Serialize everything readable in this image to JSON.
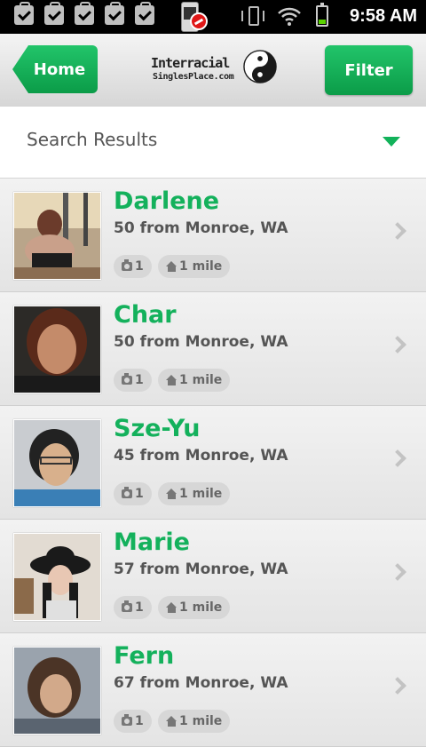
{
  "status_bar": {
    "time": "9:58 AM"
  },
  "header": {
    "home_label": "Home",
    "filter_label": "Filter",
    "logo_line1": "Interracial",
    "logo_line2": "SinglesPlace.com"
  },
  "results": {
    "label": "Search Results"
  },
  "profiles": [
    {
      "name": "Darlene",
      "location": "50 from Monroe, WA",
      "photos": "1",
      "distance": "1 mile"
    },
    {
      "name": "Char",
      "location": "50 from Monroe, WA",
      "photos": "1",
      "distance": "1 mile"
    },
    {
      "name": "Sze-Yu",
      "location": "45 from Monroe, WA",
      "photos": "1",
      "distance": "1 mile"
    },
    {
      "name": "Marie",
      "location": "57 from Monroe, WA",
      "photos": "1",
      "distance": "1 mile"
    },
    {
      "name": "Fern",
      "location": "67 from Monroe, WA",
      "photos": "1",
      "distance": "1 mile"
    }
  ],
  "colors": {
    "accent": "#14b15c"
  }
}
